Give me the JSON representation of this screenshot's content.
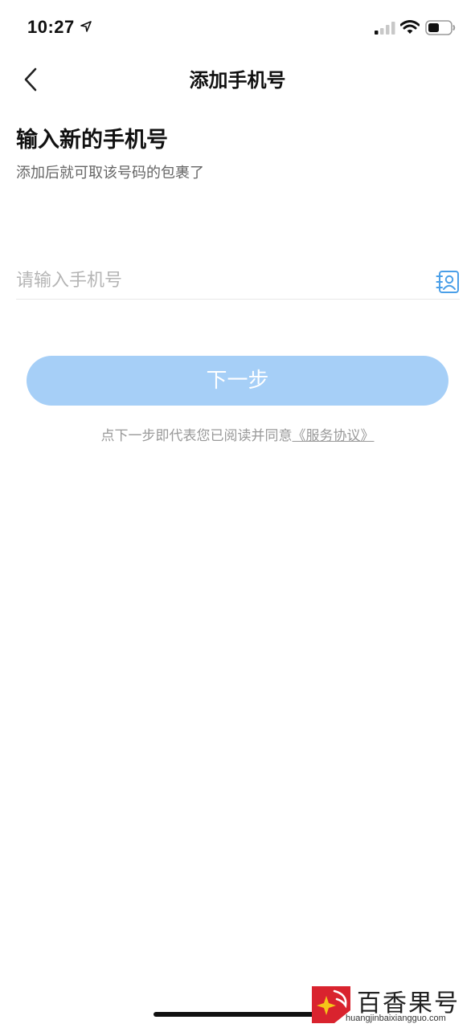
{
  "status_bar": {
    "time": "10:27"
  },
  "nav": {
    "title": "添加手机号"
  },
  "content": {
    "heading": "输入新的手机号",
    "subheading": "添加后就可取该号码的包裹了",
    "phone_input": {
      "placeholder": "请输入手机号",
      "value": ""
    },
    "next_button_label": "下一步",
    "agreement_text": "点下一步即代表您已阅读并同意",
    "agreement_link": "《服务协议》"
  },
  "colors": {
    "accent": "#4a9fe8",
    "button_disabled": "#a6cff7",
    "watermark_red": "#d9232e"
  },
  "icons": {
    "back": "chevron-left-icon",
    "contacts": "contact-book-icon"
  },
  "watermark": {
    "text": "百香果号",
    "url": "huangjinbaixiangguo.com"
  }
}
